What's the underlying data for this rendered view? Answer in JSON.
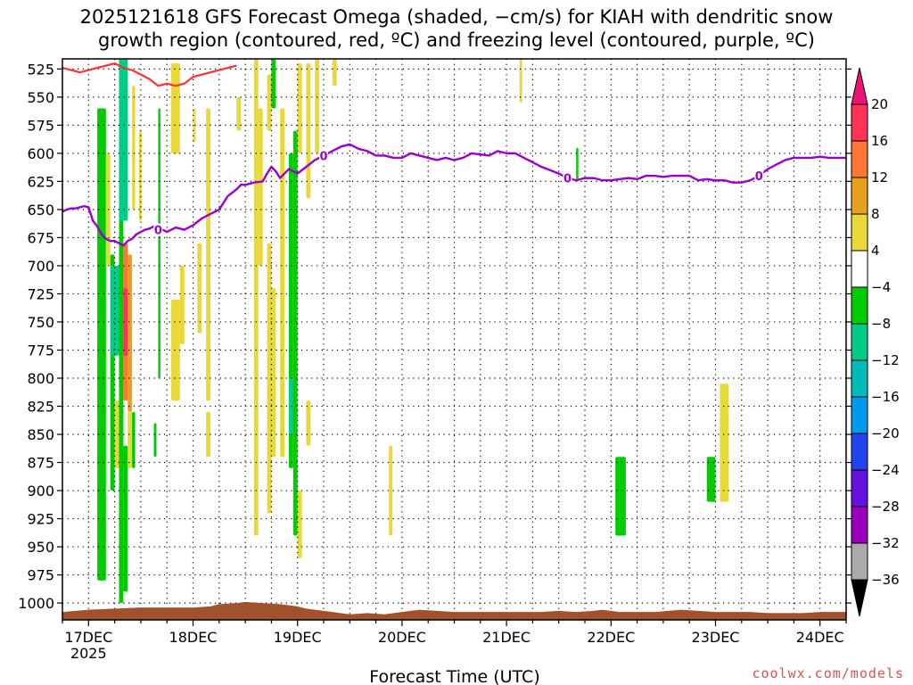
{
  "chart_data": {
    "type": "heatmap",
    "title_line1": "2025121618 GFS Forecast Omega (shaded, −cm/s) for KIAH with dendritic snow",
    "title_line2": "growth region (contoured, red, ºC) and freezing level (contoured, purple, ºC)",
    "xlabel": "Forecast Time (UTC)",
    "x_ticks": [
      {
        "t": 0,
        "label": "17DEC",
        "sub": "2025"
      },
      {
        "t": 24,
        "label": "18DEC"
      },
      {
        "t": 48,
        "label": "19DEC"
      },
      {
        "t": 72,
        "label": "20DEC"
      },
      {
        "t": 96,
        "label": "21DEC"
      },
      {
        "t": 120,
        "label": "22DEC"
      },
      {
        "t": 144,
        "label": "23DEC"
      },
      {
        "t": 168,
        "label": "24DEC"
      }
    ],
    "x_range_hours": [
      -6,
      174
    ],
    "y_ticks": [
      525,
      550,
      575,
      600,
      625,
      650,
      675,
      700,
      725,
      750,
      775,
      800,
      825,
      850,
      875,
      900,
      925,
      950,
      975,
      1000
    ],
    "y_range_hpa": [
      516,
      1015
    ],
    "colorbar": {
      "labels": [
        "20",
        "16",
        "12",
        "8",
        "4",
        "−4",
        "−8",
        "−12",
        "−16",
        "−20",
        "−24",
        "−28",
        "−32",
        "−36"
      ],
      "colors": [
        "#ff3355",
        "#ff7733",
        "#e8a020",
        "#e8d838",
        "#ffffff",
        "#00cc00",
        "#00cc88",
        "#00bbbb",
        "#0099ee",
        "#2244ee",
        "#6611dd",
        "#9900bb",
        "#aaaaaa"
      ],
      "top_arrow": "#ee1177",
      "bottom_arrow": "#000000"
    },
    "freezing_level_label": "0",
    "freezing_level_color": "#9900cc",
    "dgz_color": "#ff3333",
    "terrain_color": "#a0522d",
    "freezing_level": {
      "t": [
        -6,
        -5,
        -4,
        -3,
        -2,
        -1,
        0,
        1,
        2,
        3,
        4,
        5,
        6,
        7,
        8,
        9,
        10,
        11,
        12,
        13,
        14,
        15,
        16,
        17,
        18,
        20,
        22,
        24,
        26,
        28,
        30,
        32,
        34,
        35,
        36,
        38,
        40,
        41,
        42,
        43,
        44,
        46,
        48,
        50,
        52,
        54,
        56,
        58,
        60,
        62,
        64,
        66,
        68,
        70,
        72,
        74,
        76,
        78,
        80,
        82,
        84,
        86,
        88,
        90,
        92,
        94,
        96,
        98,
        100,
        102,
        104,
        106,
        108,
        110,
        112,
        114,
        116,
        118,
        120,
        122,
        124,
        126,
        128,
        130,
        132,
        134,
        136,
        138,
        140,
        142,
        144,
        146,
        148,
        150,
        152,
        154,
        156,
        158,
        160,
        162,
        164,
        166,
        168,
        170,
        172,
        174
      ],
      "p": [
        652,
        650,
        649,
        649,
        648,
        647,
        648,
        660,
        665,
        672,
        676,
        678,
        678,
        680,
        682,
        678,
        676,
        672,
        670,
        668,
        667,
        665,
        668,
        668,
        670,
        666,
        668,
        664,
        658,
        654,
        650,
        638,
        632,
        628,
        628,
        626,
        625,
        618,
        612,
        616,
        622,
        614,
        618,
        612,
        606,
        602,
        598,
        594,
        592,
        596,
        598,
        602,
        602,
        604,
        604,
        600,
        602,
        604,
        606,
        604,
        606,
        604,
        600,
        601,
        602,
        598,
        600,
        600,
        604,
        608,
        612,
        615,
        618,
        622,
        624,
        622,
        622,
        624,
        624,
        623,
        622,
        623,
        620,
        620,
        621,
        620,
        620,
        620,
        624,
        623,
        624,
        624,
        626,
        626,
        624,
        620,
        614,
        610,
        606,
        604,
        604,
        604,
        603,
        604,
        604,
        604
      ]
    },
    "dgz_contour": {
      "t": [
        -6,
        -4,
        -2,
        0,
        2,
        4,
        6,
        8,
        10,
        12,
        14,
        16,
        18,
        20,
        22,
        24,
        26,
        28,
        30,
        32,
        34
      ],
      "p": [
        524,
        526,
        528,
        526,
        524,
        522,
        520,
        524,
        526,
        530,
        534,
        540,
        538,
        540,
        538,
        532,
        530,
        528,
        526,
        524,
        522
      ]
    },
    "shaded_cells": [
      {
        "t0": 0,
        "t1": 2,
        "p0": 510,
        "p1": 1000,
        "c": 4
      },
      {
        "t0": 2,
        "t1": 4,
        "p0": 560,
        "p1": 980,
        "c": 5
      },
      {
        "t0": 4,
        "t1": 5,
        "p0": 600,
        "p1": 700,
        "c": 3
      },
      {
        "t0": 5,
        "t1": 6,
        "p0": 690,
        "p1": 900,
        "c": 5
      },
      {
        "t0": 5,
        "t1": 7,
        "p0": 700,
        "p1": 780,
        "c": 6
      },
      {
        "t0": 6,
        "t1": 7,
        "p0": 600,
        "p1": 700,
        "c": 4
      },
      {
        "t0": 6,
        "t1": 8,
        "p0": 820,
        "p1": 880,
        "c": 3
      },
      {
        "t0": 7,
        "t1": 8,
        "p0": 510,
        "p1": 1000,
        "c": 5
      },
      {
        "t0": 7,
        "t1": 9,
        "p0": 510,
        "p1": 660,
        "c": 6
      },
      {
        "t0": 8,
        "t1": 9,
        "p0": 860,
        "p1": 990,
        "c": 5
      },
      {
        "t0": 8,
        "t1": 9,
        "p0": 680,
        "p1": 820,
        "c": 1
      },
      {
        "t0": 8,
        "t1": 9,
        "p0": 720,
        "p1": 780,
        "c": 0
      },
      {
        "t0": 9,
        "t1": 10,
        "p0": 690,
        "p1": 830,
        "c": 2
      },
      {
        "t0": 9,
        "t1": 10,
        "p0": 830,
        "p1": 880,
        "c": 3
      },
      {
        "t0": 10,
        "t1": 10.7,
        "p0": 540,
        "p1": 650,
        "c": 3
      },
      {
        "t0": 10,
        "t1": 10.7,
        "p0": 830,
        "p1": 880,
        "c": 5
      },
      {
        "t0": 11,
        "t1": 11.6,
        "p0": 510,
        "p1": 560,
        "c": 4
      },
      {
        "t0": 11.6,
        "t1": 12.2,
        "p0": 580,
        "p1": 660,
        "c": 3
      },
      {
        "t0": 15,
        "t1": 15.6,
        "p0": 840,
        "p1": 870,
        "c": 5
      },
      {
        "t0": 16,
        "t1": 16.5,
        "p0": 560,
        "p1": 800,
        "c": 5
      },
      {
        "t0": 19,
        "t1": 21,
        "p0": 520,
        "p1": 600,
        "c": 3
      },
      {
        "t0": 19,
        "t1": 21,
        "p0": 730,
        "p1": 820,
        "c": 3
      },
      {
        "t0": 21,
        "t1": 22,
        "p0": 700,
        "p1": 770,
        "c": 3
      },
      {
        "t0": 24,
        "t1": 24.6,
        "p0": 560,
        "p1": 590,
        "c": 3
      },
      {
        "t0": 25,
        "t1": 26,
        "p0": 680,
        "p1": 760,
        "c": 3
      },
      {
        "t0": 27,
        "t1": 28,
        "p0": 560,
        "p1": 820,
        "c": 3
      },
      {
        "t0": 27,
        "t1": 28,
        "p0": 830,
        "p1": 870,
        "c": 3
      },
      {
        "t0": 34,
        "t1": 35,
        "p0": 550,
        "p1": 580,
        "c": 3
      },
      {
        "t0": 38,
        "t1": 39,
        "p0": 510,
        "p1": 940,
        "c": 3
      },
      {
        "t0": 39,
        "t1": 40,
        "p0": 560,
        "p1": 700,
        "c": 3
      },
      {
        "t0": 41,
        "t1": 42,
        "p0": 530,
        "p1": 580,
        "c": 3
      },
      {
        "t0": 41,
        "t1": 42,
        "p0": 680,
        "p1": 920,
        "c": 3
      },
      {
        "t0": 42,
        "t1": 43,
        "p0": 510,
        "p1": 560,
        "c": 5
      },
      {
        "t0": 42,
        "t1": 43,
        "p0": 720,
        "p1": 870,
        "c": 3
      },
      {
        "t0": 44,
        "t1": 45,
        "p0": 560,
        "p1": 870,
        "c": 3
      },
      {
        "t0": 46,
        "t1": 47,
        "p0": 600,
        "p1": 880,
        "c": 5
      },
      {
        "t0": 46,
        "t1": 47,
        "p0": 800,
        "p1": 850,
        "c": 6
      },
      {
        "t0": 47,
        "t1": 48,
        "p0": 580,
        "p1": 940,
        "c": 5
      },
      {
        "t0": 48,
        "t1": 49,
        "p0": 520,
        "p1": 600,
        "c": 3
      },
      {
        "t0": 48,
        "t1": 49,
        "p0": 900,
        "p1": 960,
        "c": 3
      },
      {
        "t0": 50,
        "t1": 51,
        "p0": 520,
        "p1": 640,
        "c": 3
      },
      {
        "t0": 50,
        "t1": 51,
        "p0": 820,
        "p1": 860,
        "c": 3
      },
      {
        "t0": 52,
        "t1": 53,
        "p0": 510,
        "p1": 600,
        "c": 3
      },
      {
        "t0": 56,
        "t1": 57,
        "p0": 510,
        "p1": 540,
        "c": 3
      },
      {
        "t0": 69,
        "t1": 69.8,
        "p0": 860,
        "p1": 940,
        "c": 3
      },
      {
        "t0": 99,
        "t1": 99.6,
        "p0": 510,
        "p1": 555,
        "c": 3
      },
      {
        "t0": 112,
        "t1": 112.5,
        "p0": 595,
        "p1": 625,
        "c": 5
      },
      {
        "t0": 121,
        "t1": 123.4,
        "p0": 870,
        "p1": 940,
        "c": 5
      },
      {
        "t0": 142,
        "t1": 144,
        "p0": 870,
        "p1": 910,
        "c": 5
      },
      {
        "t0": 145,
        "t1": 147,
        "p0": 805,
        "p1": 910,
        "c": 3
      }
    ],
    "terrain": {
      "t": [
        -6,
        0,
        6,
        12,
        18,
        24,
        28,
        30,
        34,
        36,
        40,
        44,
        46,
        48,
        50,
        52,
        56,
        60,
        64,
        68,
        72,
        76,
        80,
        84,
        88,
        92,
        96,
        100,
        104,
        108,
        112,
        116,
        118,
        120,
        122,
        126,
        130,
        136,
        140,
        144,
        148,
        152,
        156,
        160,
        164,
        168,
        174
      ],
      "p": [
        1008,
        1006,
        1005,
        1004,
        1004,
        1004,
        1003,
        1001,
        1000,
        999,
        1000,
        1001,
        1002,
        1003,
        1005,
        1006,
        1008,
        1010,
        1009,
        1010,
        1008,
        1006,
        1007,
        1008,
        1008,
        1008,
        1008,
        1008,
        1008,
        1007,
        1008,
        1007,
        1006,
        1007,
        1008,
        1008,
        1008,
        1006,
        1007,
        1008,
        1008,
        1008,
        1009,
        1009,
        1009,
        1008,
        1008
      ]
    }
  },
  "credit": "coolwx.com/models"
}
